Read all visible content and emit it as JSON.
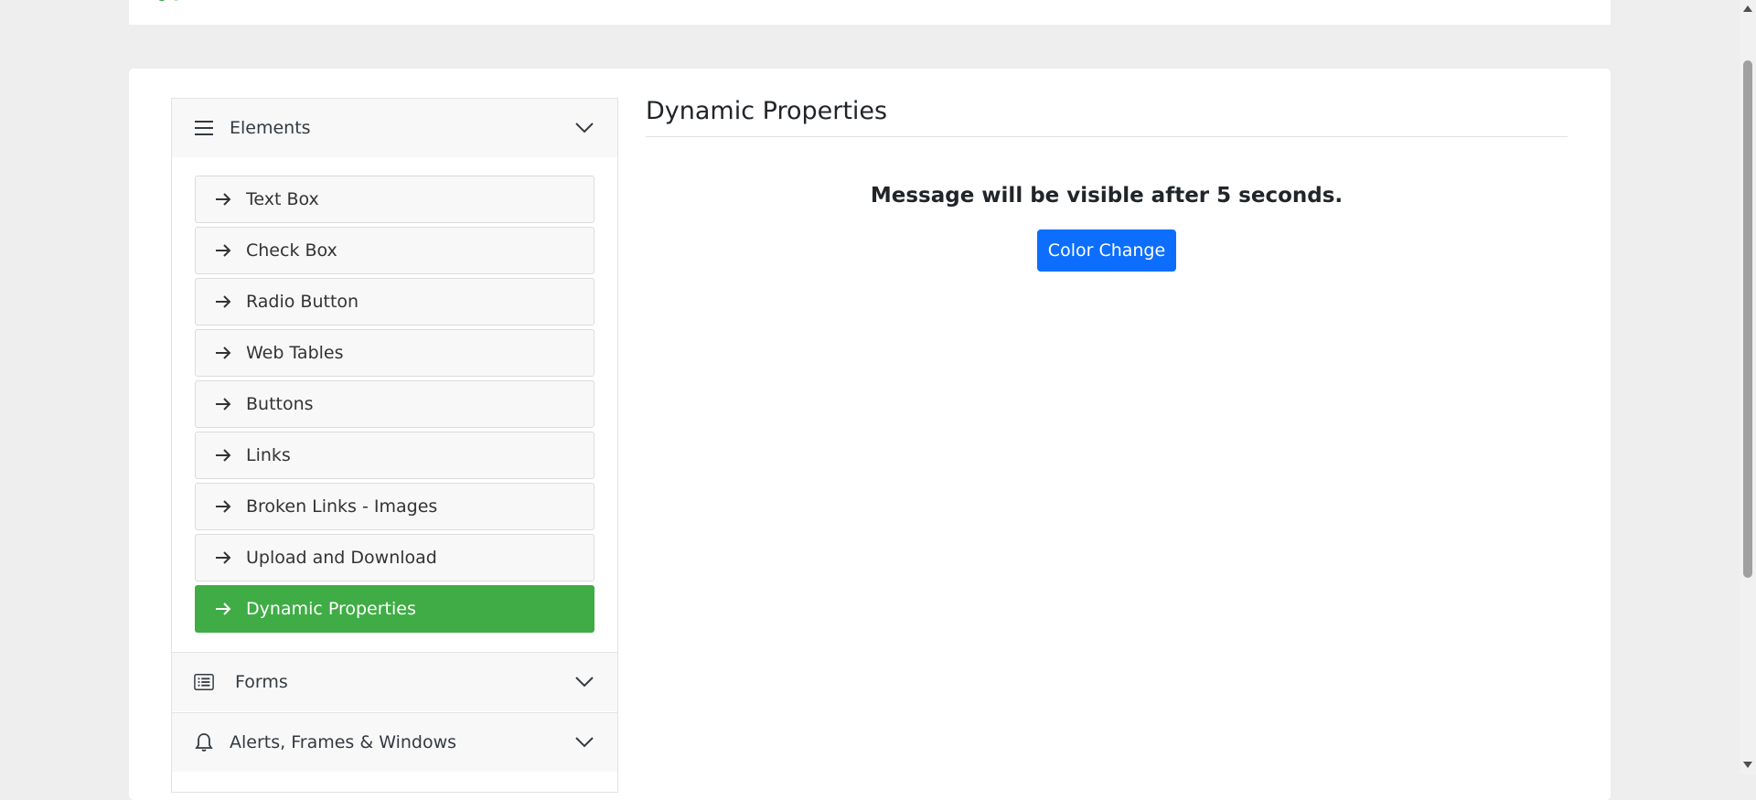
{
  "sidebar": {
    "elements_group": {
      "label": "Elements",
      "icon": "menu-icon",
      "expanded": true,
      "items": [
        {
          "label": "Text Box",
          "active": false
        },
        {
          "label": "Check Box",
          "active": false
        },
        {
          "label": "Radio Button",
          "active": false
        },
        {
          "label": "Web Tables",
          "active": false
        },
        {
          "label": "Buttons",
          "active": false
        },
        {
          "label": "Links",
          "active": false
        },
        {
          "label": "Broken Links - Images",
          "active": false
        },
        {
          "label": "Upload and Download",
          "active": false
        },
        {
          "label": "Dynamic Properties",
          "active": true
        }
      ]
    },
    "forms_group": {
      "label": "Forms",
      "icon": "list-icon"
    },
    "alerts_group": {
      "label": "Alerts, Frames & Windows",
      "icon": "bell-icon"
    }
  },
  "main": {
    "title": "Dynamic Properties",
    "message": "Message will be visible after 5 seconds.",
    "color_change_label": "Color Change"
  },
  "colors": {
    "active_item": "#3fac45",
    "primary_button": "#0d6efd",
    "page_background": "#eeeeee"
  }
}
